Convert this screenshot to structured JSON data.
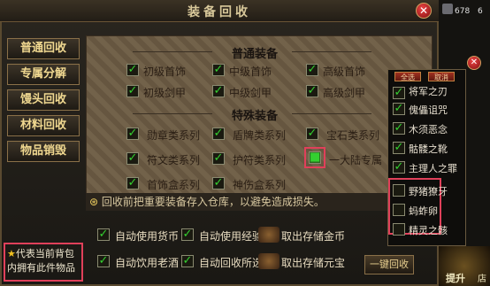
{
  "window": {
    "title": "装备回收"
  },
  "top_right": {
    "count_a": "678",
    "count_b": "6"
  },
  "sidebar": {
    "items": [
      {
        "label": "普通回收"
      },
      {
        "label": "专属分解"
      },
      {
        "label": "馒头回收"
      },
      {
        "label": "材料回收"
      },
      {
        "label": "物品销毁"
      }
    ]
  },
  "normal_section": {
    "title": "普通装备",
    "items": [
      {
        "label": "初级首饰",
        "checked": true
      },
      {
        "label": "中级首饰",
        "checked": true
      },
      {
        "label": "高级首饰",
        "checked": true
      },
      {
        "label": "初级剑甲",
        "checked": true
      },
      {
        "label": "中级剑甲",
        "checked": true
      },
      {
        "label": "高级剑甲",
        "checked": true
      }
    ]
  },
  "special_section": {
    "title": "特殊装备",
    "items": [
      {
        "label": "勋章类系列",
        "checked": true
      },
      {
        "label": "盾牌类系列",
        "checked": true
      },
      {
        "label": "宝石类系列",
        "checked": true
      },
      {
        "label": "符文类系列",
        "checked": true
      },
      {
        "label": "护符类系列",
        "checked": true
      },
      {
        "label": "一大陆专属",
        "checked": true
      },
      {
        "label": "首饰盒系列",
        "checked": true
      },
      {
        "label": "神伤盒系列",
        "checked": true
      }
    ]
  },
  "warning": "回收前把重要装备存入仓库，以避免造成损失。",
  "options": {
    "row1": [
      {
        "label": "自动使用货币",
        "checked": true
      },
      {
        "label": "自动使用经验",
        "checked": true
      },
      {
        "label": "取出存储金币",
        "checked": null
      }
    ],
    "row2": [
      {
        "label": "自动饮用老酒",
        "checked": true
      },
      {
        "label": "自动回收所选",
        "checked": true
      },
      {
        "label": "取出存储元宝",
        "checked": null
      }
    ]
  },
  "one_click_button": "一键回收",
  "legend_note": "代表当前背包内拥有此件物品",
  "popup": {
    "btn_all": "全选",
    "btn_cancel": "取消",
    "items": [
      {
        "label": "将军之刃",
        "checked": true
      },
      {
        "label": "傀儡诅咒",
        "checked": true
      },
      {
        "label": "木须恶念",
        "checked": true
      },
      {
        "label": "骷髅之靴",
        "checked": true
      },
      {
        "label": "主理人之罪",
        "checked": true
      },
      {
        "label": "野猪獠牙",
        "checked": false
      },
      {
        "label": "蚂蚱卵",
        "checked": false
      },
      {
        "label": "精灵之骸",
        "checked": false
      }
    ]
  },
  "bottom_right_label": "提升",
  "bottom_right_label2": "店"
}
